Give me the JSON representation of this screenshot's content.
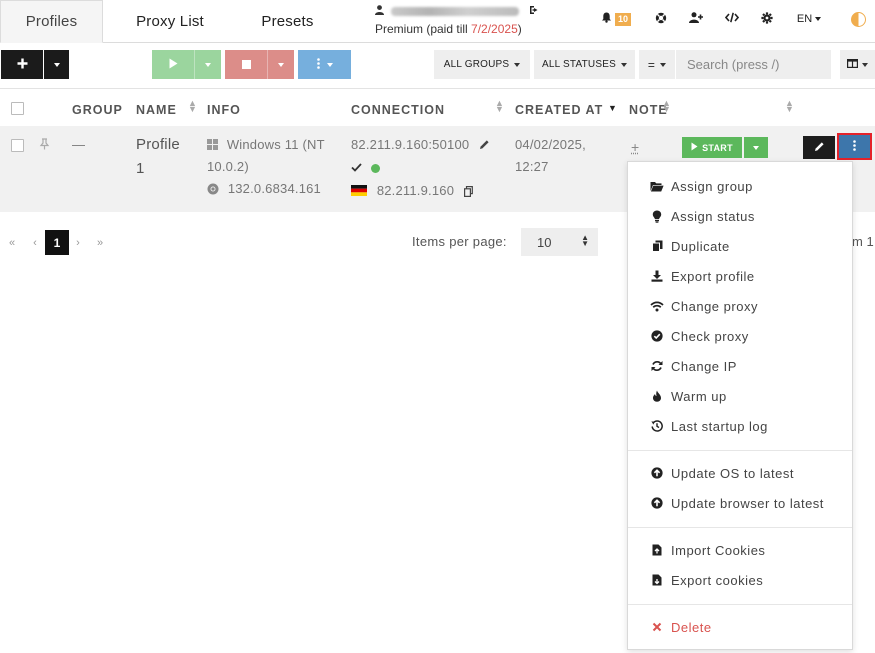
{
  "tabs": {
    "profiles": "Profiles",
    "proxy_list": "Proxy List",
    "presets": "Presets"
  },
  "account": {
    "plan": "Premium (paid till ",
    "paid_till": "7/2/2025",
    "close_paren": ")"
  },
  "header": {
    "notification_count": "10",
    "language": "EN"
  },
  "toolbar": {
    "filter_groups": "ALL GROUPS",
    "filter_statuses": "ALL STATUSES",
    "operator": "=",
    "search_placeholder": "Search (press /)"
  },
  "table": {
    "columns": {
      "group": "GROUP",
      "name": "NAME",
      "info": "INFO",
      "connection": "CONNECTION",
      "created_at": "CREATED AT",
      "note": "NOTE"
    },
    "row": {
      "group": "—",
      "name_line1": "Profile",
      "name_line2": "1",
      "os_line1": "Windows 11 (NT",
      "os_line2": "10.0.2)",
      "browser_version": "132.0.6834.161",
      "proxy": "82.211.9.160:50100",
      "ip": "82.211.9.160",
      "created_date": "04/02/2025,",
      "created_time": "12:27",
      "note_add": "+",
      "start_label": "START",
      "proxy_status_color": "#5cb85c",
      "country_flag": "germany"
    }
  },
  "pagination": {
    "first": "«",
    "prev": "‹",
    "current_page": "1",
    "next": "›",
    "last": "»",
    "items_per_page_label": "Items per page:",
    "items_per_page_value": "10",
    "range_text_fragment": "m 1"
  },
  "menu": {
    "assign_group": "Assign group",
    "assign_status": "Assign status",
    "duplicate": "Duplicate",
    "export_profile": "Export profile",
    "change_proxy": "Change proxy",
    "check_proxy": "Check proxy",
    "change_ip": "Change IP",
    "warm_up": "Warm up",
    "last_startup_log": "Last startup log",
    "update_os": "Update OS to latest",
    "update_browser": "Update browser to latest",
    "import_cookies": "Import Cookies",
    "export_cookies": "Export cookies",
    "delete": "Delete"
  },
  "colors": {
    "start_green": "#5cb85c",
    "more_button_blue": "#3d76ab",
    "highlight_red": "#e4222a",
    "danger_red": "#d9534f",
    "badge_orange": "#f0ad4e"
  }
}
